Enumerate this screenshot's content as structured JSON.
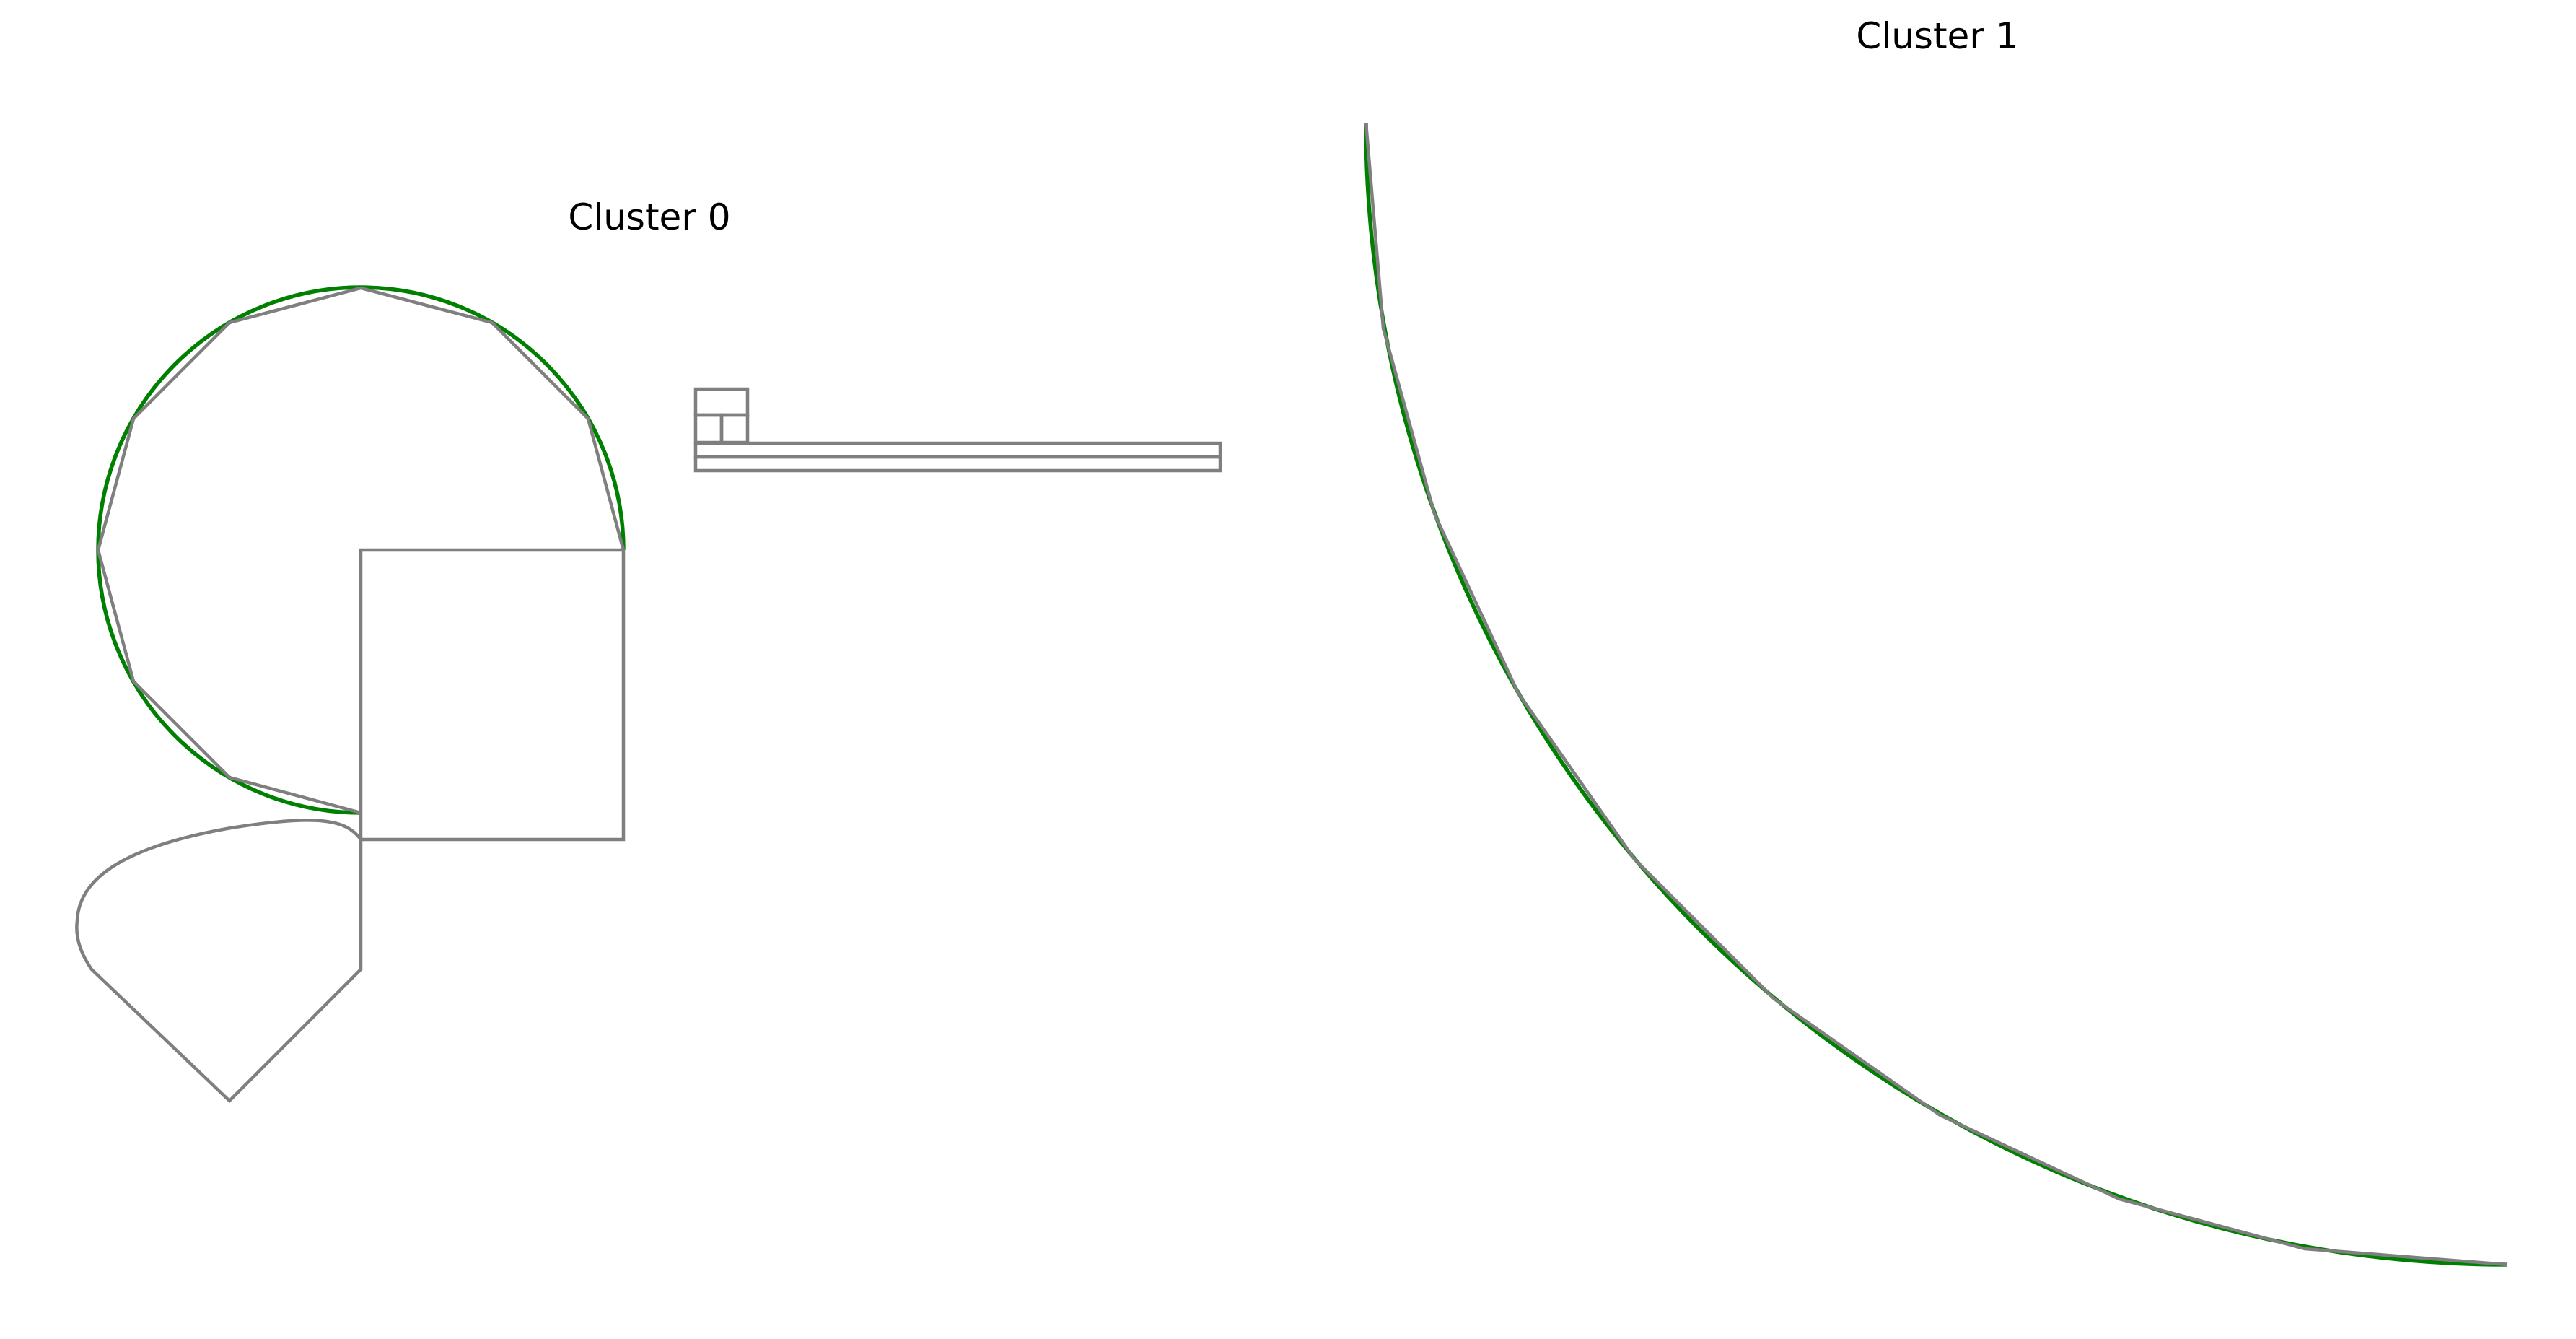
{
  "clusters": [
    {
      "label": "Cluster 0"
    },
    {
      "label": "Cluster 1"
    }
  ],
  "colors": {
    "outline": "#7f7f7f",
    "fitted_curve": "#008000",
    "text": "#000000",
    "background": "#ffffff"
  }
}
